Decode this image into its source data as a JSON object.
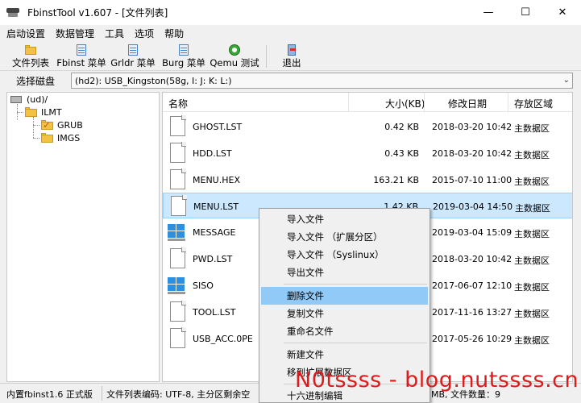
{
  "window": {
    "title": "FbinstTool v1.607 - [文件列表]"
  },
  "window_buttons": {
    "minimize": "—",
    "maximize": "☐",
    "close": "✕"
  },
  "menubar": [
    "启动设置",
    "数据管理",
    "工具",
    "选项",
    "帮助"
  ],
  "toolbar": {
    "file_list": "文件列表",
    "fbinst_menu": "Fbinst 菜单",
    "grldr_menu": "Grldr 菜单",
    "burg_menu": "Burg 菜单",
    "qemu_test": "Qemu 测试",
    "exit": "退出"
  },
  "disk": {
    "label": "选择磁盘",
    "selected": "(hd2): USB_Kingston(58g, I: J: K: L:)"
  },
  "tree": {
    "root": "(ud)/",
    "ilmt": "ILMT",
    "grub": "GRUB",
    "imgs": "IMGS"
  },
  "columns": {
    "name": "名称",
    "size": "大小(KB)",
    "date": "修改日期",
    "zone": "存放区域"
  },
  "files": [
    {
      "name": "GHOST.LST",
      "size": "0.42 KB",
      "date": "2018-03-20 10:42",
      "zone": "主数据区",
      "icon": "document-icon"
    },
    {
      "name": "HDD.LST",
      "size": "0.43 KB",
      "date": "2018-03-20 10:42",
      "zone": "主数据区",
      "icon": "document-icon"
    },
    {
      "name": "MENU.HEX",
      "size": "163.21 KB",
      "date": "2015-07-10 11:00",
      "zone": "主数据区",
      "icon": "document-icon"
    },
    {
      "name": "MENU.LST",
      "size": "1.42 KB",
      "date": "2019-03-04 14:50",
      "zone": "主数据区",
      "icon": "document-icon"
    },
    {
      "name": "MESSAGE",
      "size": "",
      "date": "2019-03-04 15:09",
      "zone": "主数据区",
      "icon": "windows-icon"
    },
    {
      "name": "PWD.LST",
      "size": "",
      "date": "2018-03-20 10:42",
      "zone": "主数据区",
      "icon": "document-icon"
    },
    {
      "name": "SISO",
      "size": "",
      "date": "2017-06-07 12:10",
      "zone": "主数据区",
      "icon": "windows-icon"
    },
    {
      "name": "TOOL.LST",
      "size": "",
      "date": "2017-11-16 13:27",
      "zone": "主数据区",
      "icon": "document-icon"
    },
    {
      "name": "USB_ACC.0PE",
      "size": "",
      "date": "2017-05-26 10:29",
      "zone": "主数据区",
      "icon": "document-icon"
    }
  ],
  "context_menu": [
    "导入文件",
    "导入文件 （扩展分区）",
    "导入文件 （Syslinux）",
    "导出文件",
    "删除文件",
    "复制文件",
    "重命名文件",
    "新建文件",
    "移到扩展数据区",
    "十六进制编辑"
  ],
  "status": {
    "left": "内置fbinst1.6 正式版",
    "middle": "文件列表编码: UTF-8, 主分区剩余空",
    "right": "3MB, 文件数量：9"
  },
  "watermark": "N0tssss - blog.nutssss.cn",
  "colors": {
    "selection": "#cce8ff",
    "menu_highlight": "#91c9f7",
    "watermark": "#e01a1a"
  }
}
